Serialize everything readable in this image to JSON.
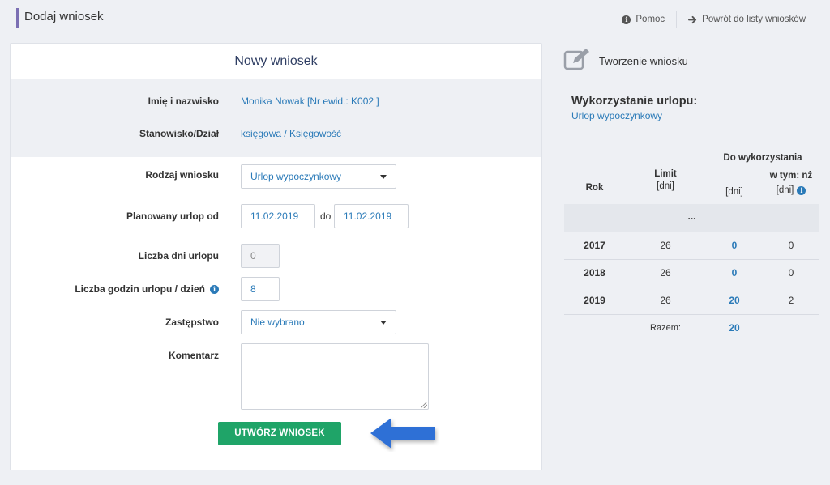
{
  "header": {
    "title": "Dodaj wniosek",
    "help_label": "Pomoc",
    "back_label": "Powrót do listy wniosków"
  },
  "form": {
    "title": "Nowy wniosek",
    "name_label": "Imię i nazwisko",
    "name_value": "Monika Nowak [Nr ewid.: K002 ]",
    "position_label": "Stanowisko/Dział",
    "position_value": "księgowa / Księgowość",
    "type_label": "Rodzaj wniosku",
    "type_value": "Urlop wypoczynkowy",
    "planned_label": "Planowany urlop od",
    "date_from": "11.02.2019",
    "date_to_label": "do",
    "date_to": "11.02.2019",
    "days_label": "Liczba dni urlopu",
    "days_value": "0",
    "hours_label": "Liczba godzin urlopu / dzień",
    "hours_value": "8",
    "substitute_label": "Zastępstwo",
    "substitute_value": "Nie wybrano",
    "comment_label": "Komentarz",
    "comment_value": "",
    "submit_label": "UTWÓRZ WNIOSEK"
  },
  "panel": {
    "head_label": "Tworzenie wniosku",
    "usage_title": "Wykorzystanie urlopu:",
    "usage_type": "Urlop wypoczynkowy",
    "table": {
      "group_header": "Do wykorzystania",
      "col_rok": "Rok",
      "col_limit_1": "Limit",
      "col_limit_2": "[dni]",
      "col_dni": "[dni]",
      "col_wtym_1": "w tym: nż",
      "col_wtym_2": "[dni]",
      "ellipsis": "...",
      "rows": [
        {
          "year": "2017",
          "limit": "26",
          "available": "0",
          "nz": "0"
        },
        {
          "year": "2018",
          "limit": "26",
          "available": "0",
          "nz": "0"
        },
        {
          "year": "2019",
          "limit": "26",
          "available": "20",
          "nz": "2"
        }
      ],
      "total_label": "Razem:",
      "total_value": "20"
    }
  },
  "colors": {
    "accent": "#7b6fb3",
    "link": "#2a7ab8",
    "submit": "#1fa468",
    "arrow": "#2f6fd6"
  },
  "icons": {
    "help": "info-circle-icon",
    "back": "arrow-right-icon",
    "create": "edit-icon",
    "info": "info-circle-icon",
    "pointer": "arrow-left-icon"
  }
}
